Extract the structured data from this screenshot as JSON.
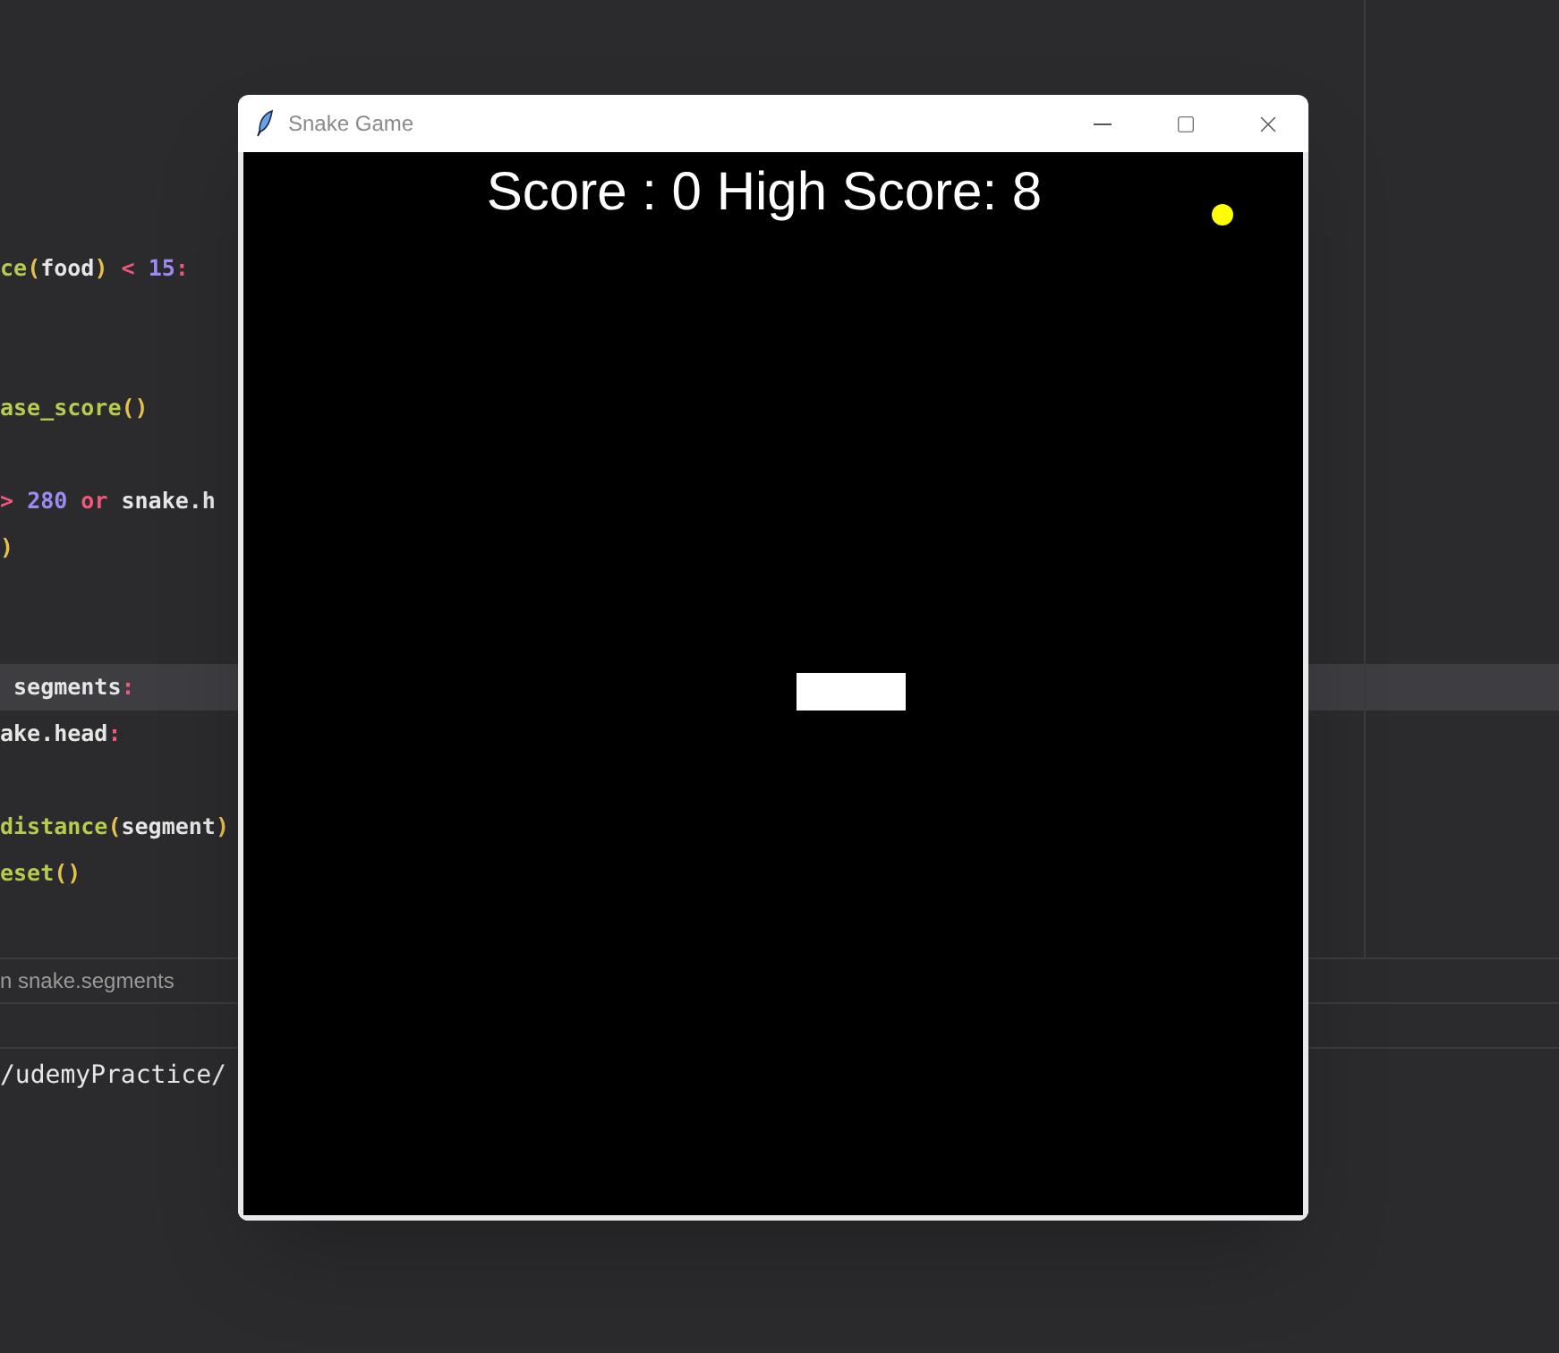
{
  "editor": {
    "lines": [
      {
        "selected": false,
        "tokens": [
          {
            "text": "ce",
            "color": "#b5cc4f"
          },
          {
            "text": "(",
            "color": "#e5c04a"
          },
          {
            "text": "food",
            "color": "#e6e6e6"
          },
          {
            "text": ")",
            "color": "#e5c04a"
          },
          {
            "text": " < ",
            "color": "#f2587a"
          },
          {
            "text": "15",
            "color": "#9b8cf2"
          },
          {
            "text": ":",
            "color": "#f2587a"
          }
        ]
      },
      {
        "selected": false
      },
      {
        "selected": false
      },
      {
        "selected": false,
        "tokens": [
          {
            "text": "ase_score",
            "color": "#b5cc4f"
          },
          {
            "text": "()",
            "color": "#e5c04a"
          }
        ]
      },
      {
        "selected": false
      },
      {
        "selected": false,
        "tokens": [
          {
            "text": "> ",
            "color": "#f2587a"
          },
          {
            "text": "280",
            "color": "#9b8cf2"
          },
          {
            "text": " or ",
            "color": "#f2587a"
          },
          {
            "text": "snake.h",
            "color": "#e6e6e6"
          }
        ]
      },
      {
        "selected": false,
        "tokens": [
          {
            "text": ")",
            "color": "#e5c04a"
          }
        ]
      },
      {
        "selected": false
      },
      {
        "selected": false
      },
      {
        "selected": true,
        "tokens": [
          {
            "text": " segments",
            "color": "#e6e6e6"
          },
          {
            "text": ":",
            "color": "#f2587a"
          }
        ]
      },
      {
        "selected": false,
        "tokens": [
          {
            "text": "ake.head",
            "color": "#e6e6e6"
          },
          {
            "text": ":",
            "color": "#f2587a"
          }
        ]
      },
      {
        "selected": false
      },
      {
        "selected": false,
        "tokens": [
          {
            "text": "distance",
            "color": "#b5cc4f"
          },
          {
            "text": "(",
            "color": "#e5c04a"
          },
          {
            "text": "segment",
            "color": "#e6e6e6"
          },
          {
            "text": ")",
            "color": "#e5c04a"
          }
        ]
      },
      {
        "selected": false,
        "tokens": [
          {
            "text": "eset",
            "color": "#b5cc4f"
          },
          {
            "text": "()",
            "color": "#e5c04a"
          }
        ]
      }
    ]
  },
  "breadcrumb": "n snake.segments",
  "terminal_line": "/udemyPractice/",
  "game_window": {
    "title": "Snake Game",
    "score_text": "Score : 0 High Score: 8"
  }
}
